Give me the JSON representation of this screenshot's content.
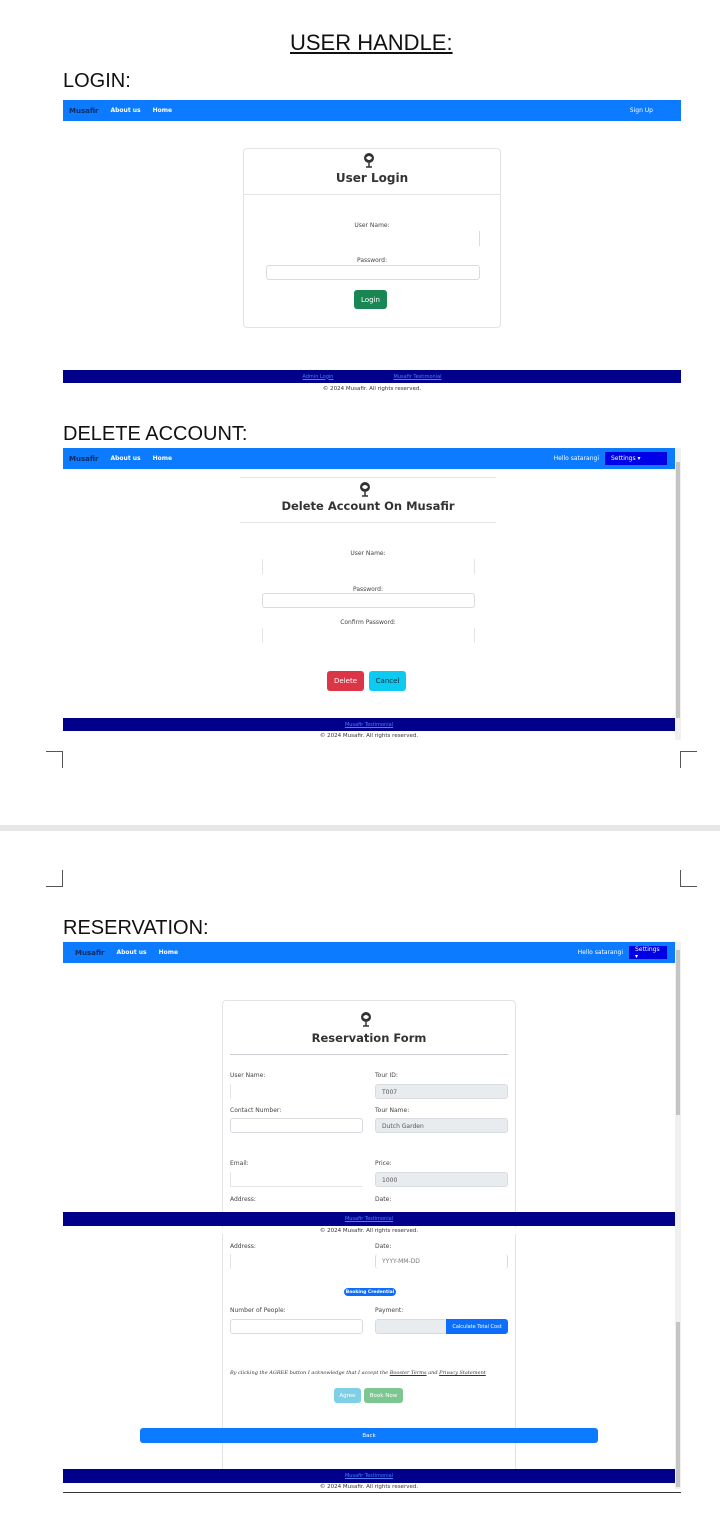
{
  "document": {
    "heading": "USER HANDLE:",
    "sections": {
      "login": "LOGIN:",
      "delete": "DELETE ACCOUNT:",
      "reservation": "RESERVATION:"
    }
  },
  "navbar": {
    "brand": "Musafir",
    "about": "About us",
    "home": "Home",
    "signup": "Sign Up",
    "hello": "Hello satarangi",
    "settings": "Settings ▾"
  },
  "footer": {
    "admin_link": "Admin Login",
    "testimonial": "Musafir Testimonial",
    "copyright": "© 2024 Musafir. All rights reserved."
  },
  "login": {
    "icon": "globe-pin-icon",
    "title": "User Login",
    "username_label": "User Name:",
    "password_label": "Password:",
    "login_button": "Login"
  },
  "delete_account": {
    "icon": "globe-pin-icon",
    "title": "Delete Account On Musafir",
    "username_label": "User Name:",
    "password_label": "Password:",
    "confirm_label": "Confirm Password:",
    "delete_button": "Delete",
    "cancel_button": "Cancel"
  },
  "reservation": {
    "icon": "globe-pin-icon",
    "title": "Reservation Form",
    "user_name_label": "User Name:",
    "tour_id_label": "Tour ID:",
    "tour_id_value": "T007",
    "contact_label": "Contact Number:",
    "tour_name_label": "Tour Name:",
    "tour_name_value": "Dutch Garden",
    "email_label": "Email:",
    "price_label": "Price:",
    "price_value": "1000",
    "address_label": "Address:",
    "date_label": "Date:",
    "date_placeholder": "YYYY-MM-DD",
    "booking_badge": "Booking Credential",
    "people_label": "Number of People:",
    "payment_label": "Payment:",
    "calc_button": "Calculate Total Cost",
    "agree_text_prefix": "By clicking the AGREE button I acknowledge that I accept the ",
    "agree_link1": "Booster Terms",
    "agree_text_mid": " and ",
    "agree_link2": "Privacy Statement",
    "agree_button": "Agree",
    "book_button": "Book Now",
    "back_button": "Back"
  },
  "colors": {
    "navbar": "#0d7bff",
    "footer": "#00008b",
    "login_green": "#198754",
    "delete_red": "#dc3545",
    "cancel_cyan": "#0dcaf0",
    "calc_blue": "#0d6efd"
  }
}
